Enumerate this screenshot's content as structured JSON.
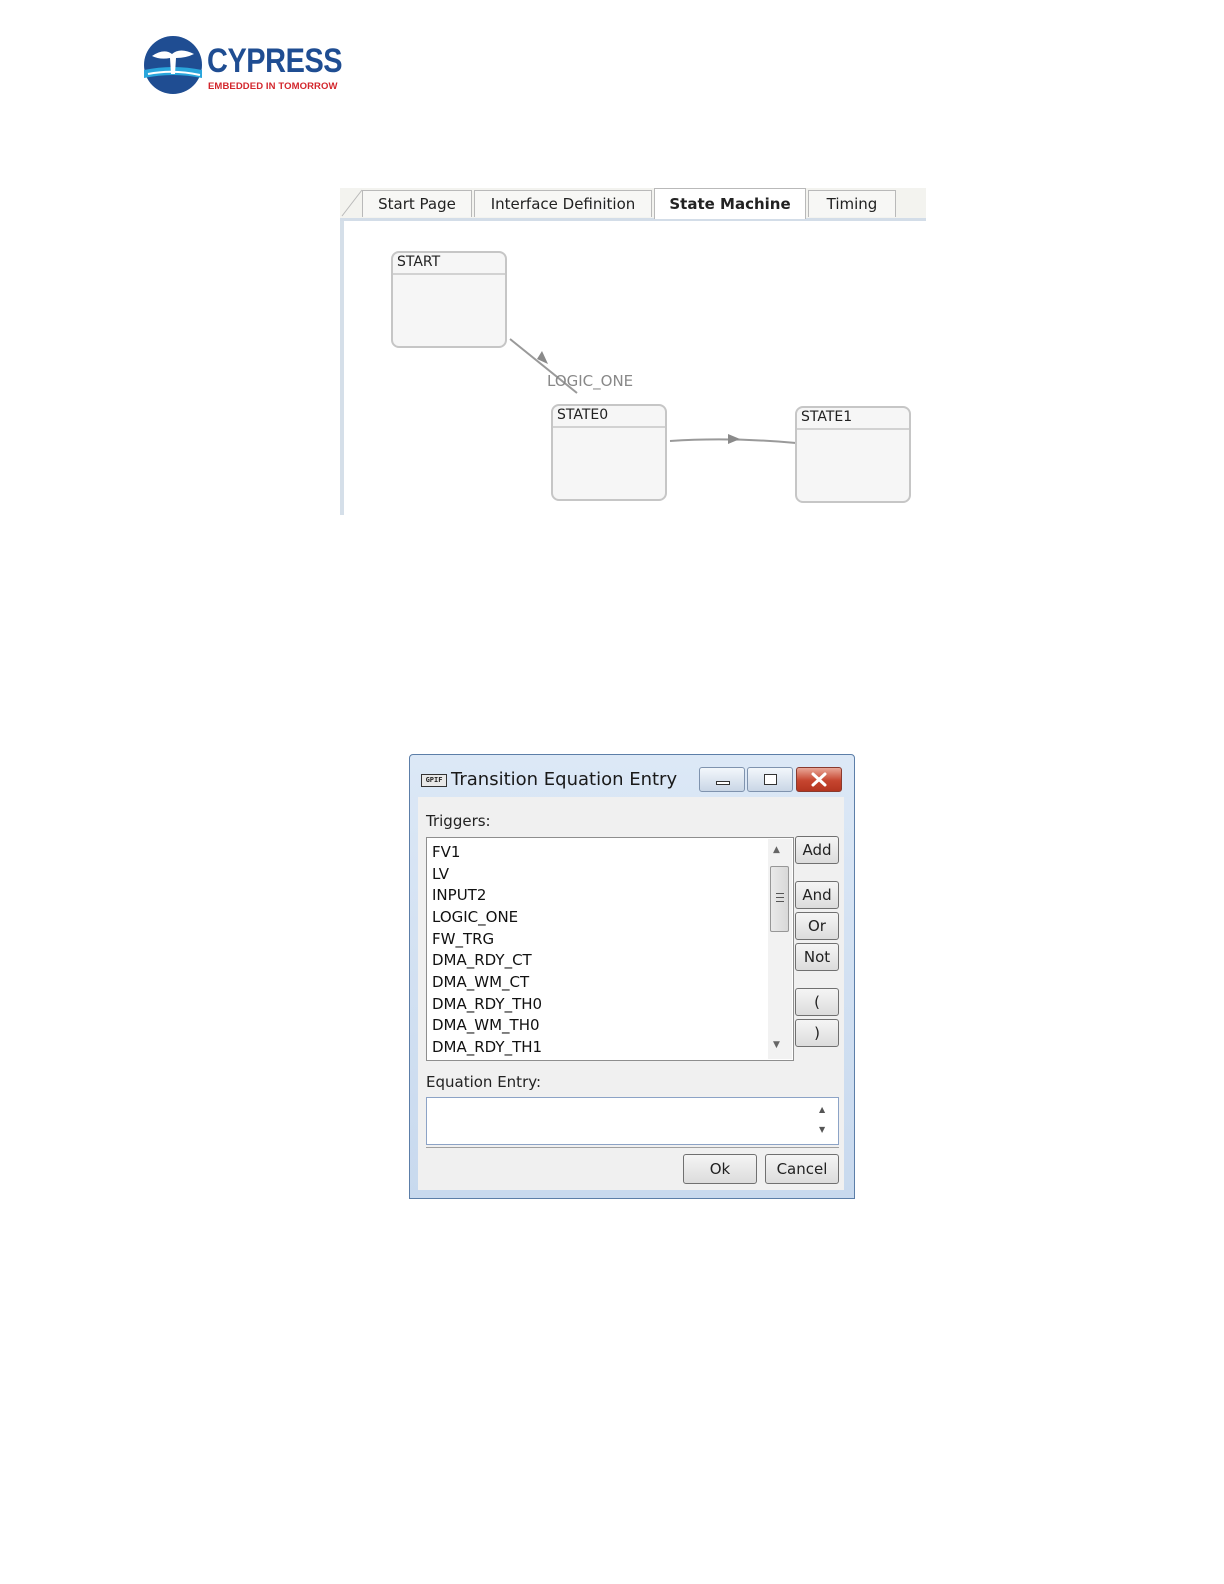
{
  "logo": {
    "brand": "CYPRESS",
    "tagline": "EMBEDDED IN TOMORROW"
  },
  "editor": {
    "tabs": [
      {
        "label": "Start Page",
        "active": false
      },
      {
        "label": "Interface Definition",
        "active": false
      },
      {
        "label": "State Machine",
        "active": true
      },
      {
        "label": "Timing",
        "active": false
      }
    ],
    "states": [
      "START",
      "STATE0",
      "STATE1"
    ],
    "transition_label": "LOGIC_ONE"
  },
  "dialog": {
    "app_icon": "GPIF",
    "title": "Transition Equation Entry",
    "triggers_label": "Triggers:",
    "triggers": [
      "FV1",
      "LV",
      "INPUT2",
      "LOGIC_ONE",
      "FW_TRG",
      "DMA_RDY_CT",
      "DMA_WM_CT",
      "DMA_RDY_TH0",
      "DMA_WM_TH0",
      "DMA_RDY_TH1"
    ],
    "buttons": {
      "add": "Add",
      "and": "And",
      "or": "Or",
      "not": "Not",
      "open_paren": "(",
      "close_paren": ")"
    },
    "equation_label": "Equation Entry:",
    "equation_value": "",
    "ok": "Ok",
    "cancel": "Cancel"
  },
  "colors": {
    "brand_blue": "#1f4d92",
    "brand_red": "#d3262c",
    "close_red": "#c6452f",
    "title_bar": "#dce8f6"
  }
}
